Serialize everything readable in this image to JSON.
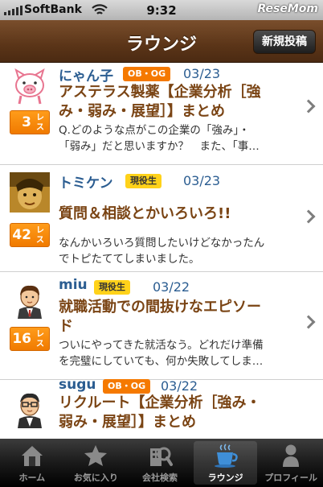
{
  "status": {
    "carrier": "SoftBank",
    "time": "9:32",
    "watermark": "ReseMom"
  },
  "nav": {
    "title": "ラウンジ",
    "post_button": "新規投稿"
  },
  "posts": [
    {
      "author": "にゃん子",
      "badge": "OB・OG",
      "date": "03/23",
      "count": "3",
      "count_unit": "レス",
      "title_lines": [
        "アステラス製薬【企業分析［強",
        "み・弱み・展望］】まとめ"
      ],
      "excerpt_lines": [
        "Q.どのような点がこの企業の「強み」・",
        "「弱み」だと思いますか？　また、「事…"
      ],
      "avatar": "pig-avatar"
    },
    {
      "author": "トミケン",
      "badge": "現役生",
      "date": "03/23",
      "count": "42",
      "count_unit": "レス",
      "title_lines": [
        "質問＆相談とかいろいろ!!"
      ],
      "excerpt_lines": [
        "なんかいろいろ質問したいけどなかったん",
        "でトピたててしまいました。"
      ],
      "avatar": "photo-avatar"
    },
    {
      "author": "miu",
      "badge": "現役生",
      "date": "03/22",
      "count": "16",
      "count_unit": "レス",
      "title_lines": [
        "就職活動での間抜けなエピソー",
        "ド"
      ],
      "excerpt_lines": [
        "ついにやってきた就活なう。どれだけ準備",
        "を完璧にしていても、何か失敗してしま…"
      ],
      "avatar": "student-avatar"
    },
    {
      "author": "sugu",
      "badge": "OB・OG",
      "date": "03/22",
      "count": "",
      "count_unit": "",
      "title_lines": [
        "リクルート【企業分析［強み・",
        "弱み・展望］】まとめ"
      ],
      "excerpt_lines": [],
      "avatar": "glasses-avatar"
    }
  ],
  "tabs": [
    {
      "label": "ホーム",
      "icon": "home-icon"
    },
    {
      "label": "お気に入り",
      "icon": "star-icon"
    },
    {
      "label": "会社検索",
      "icon": "search-building-icon"
    },
    {
      "label": "ラウンジ",
      "icon": "coffee-cup-icon"
    },
    {
      "label": "プロフィール",
      "icon": "person-icon"
    }
  ],
  "colors": {
    "nav": "#5b3518",
    "accent_orange": "#f07a00",
    "link_blue": "#2b5d91",
    "title_brown": "#7a4414"
  }
}
